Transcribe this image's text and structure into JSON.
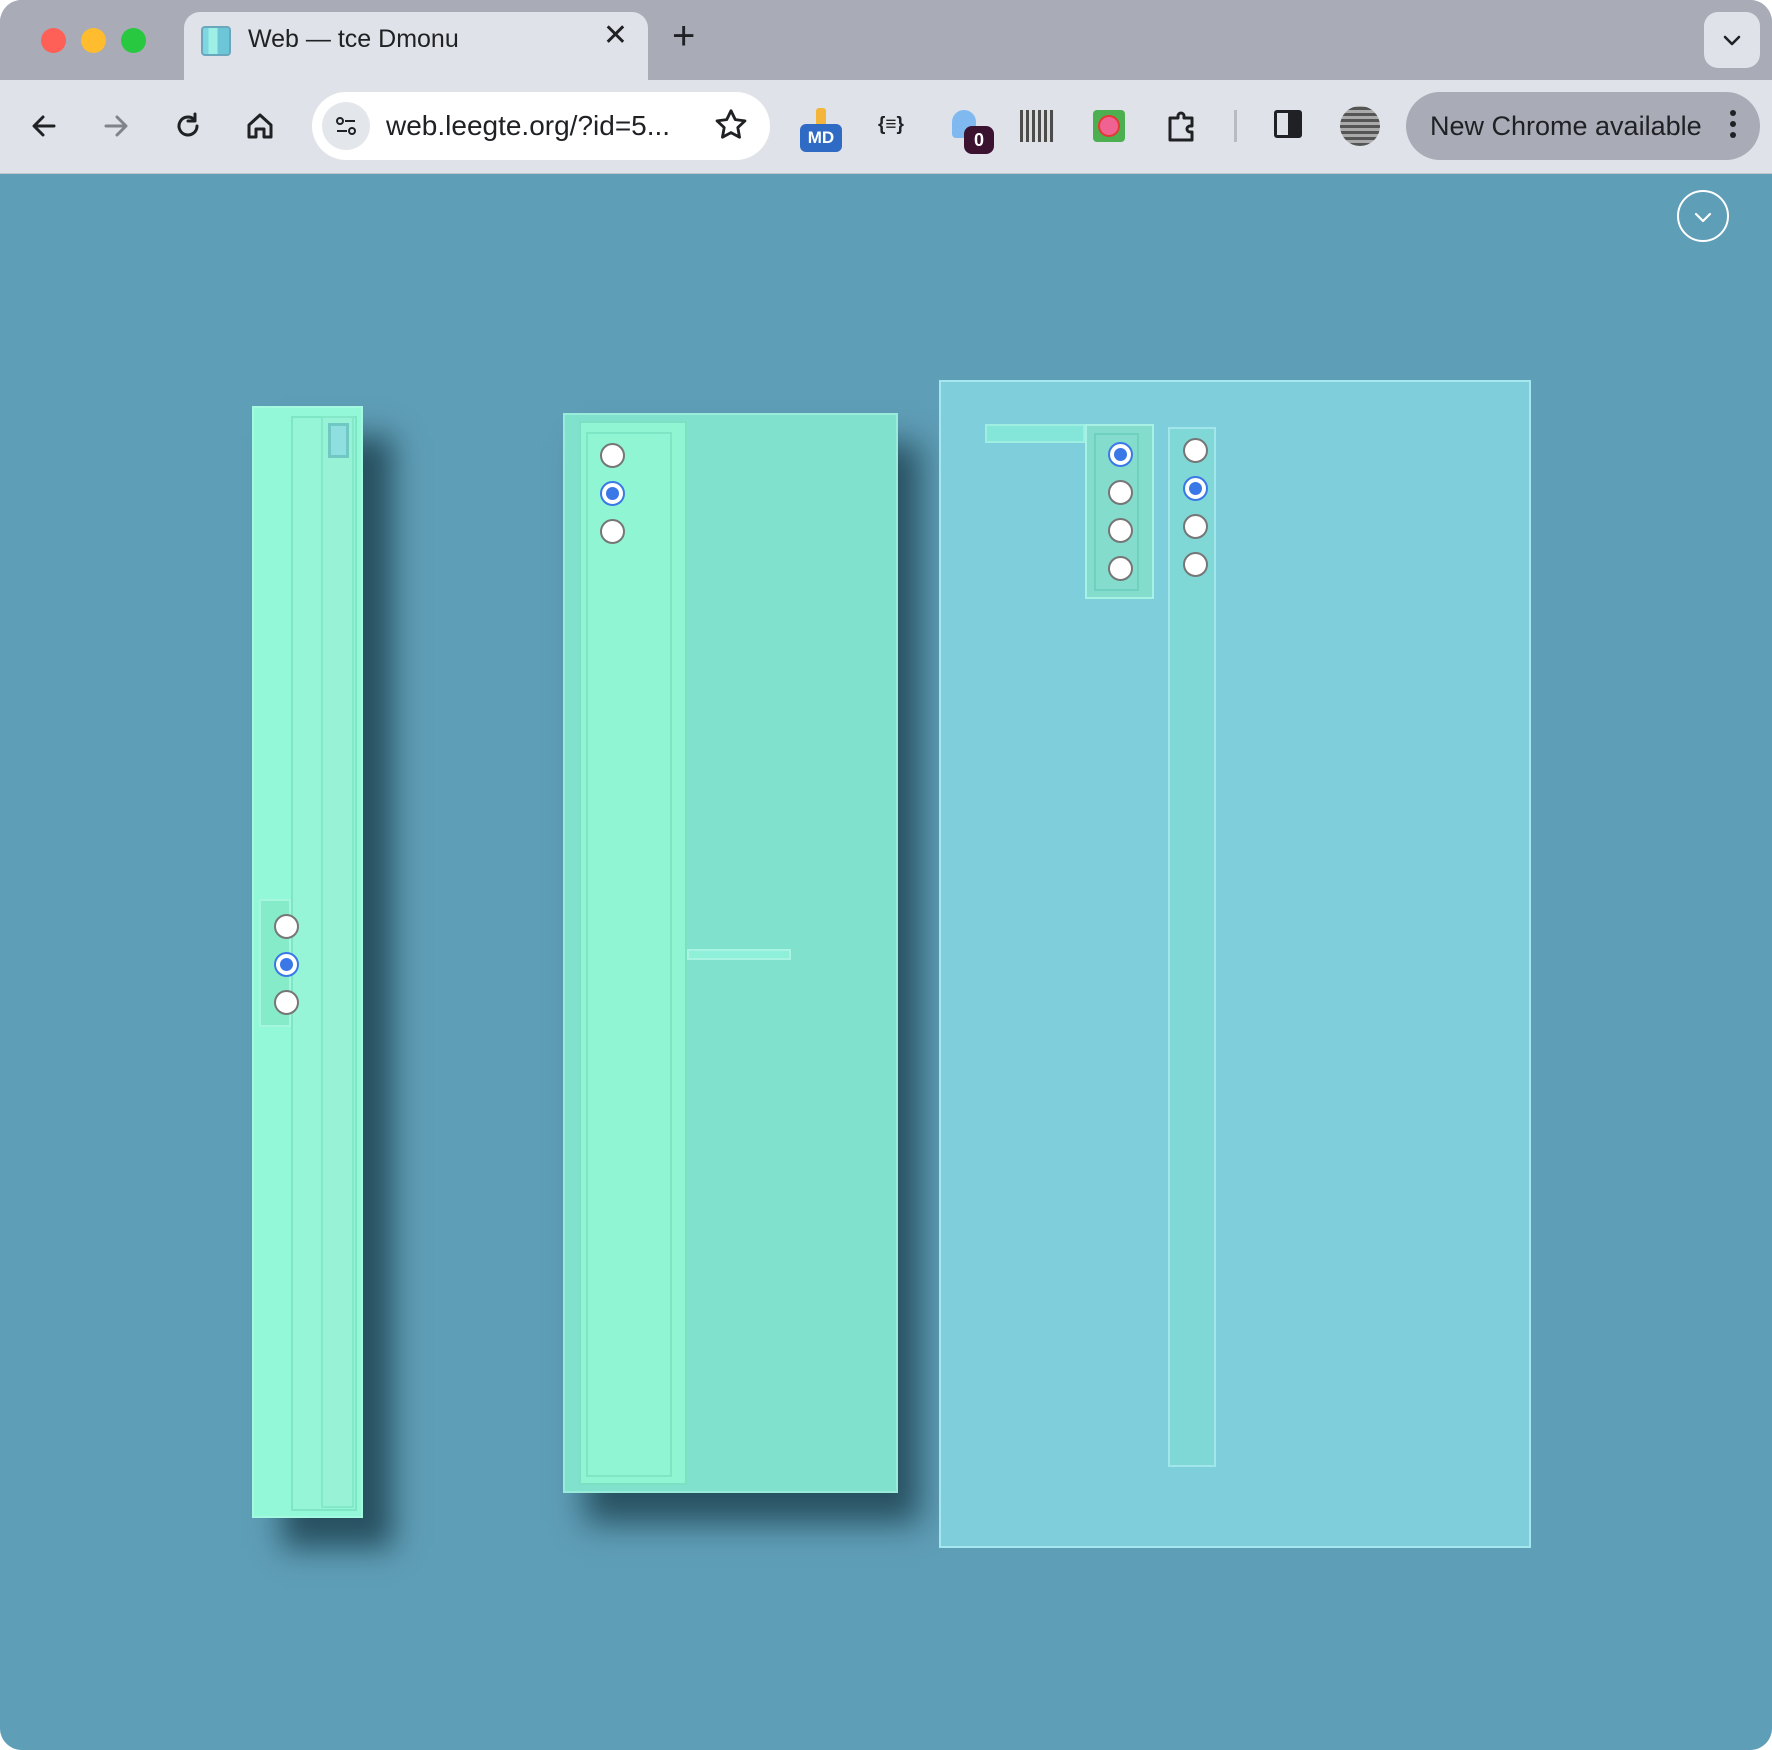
{
  "browser": {
    "tab_title": "Web — tce Dmonu",
    "url": "web.leegte.org/?id=5...",
    "update_label": "New Chrome available",
    "extension_md_label": "MD",
    "extension_ghost_count": "0",
    "extension_braces_label": "{≡}"
  },
  "page": {
    "background_color": "#5f9eb7",
    "panels": [
      {
        "name": "left-panel",
        "color": "#92f8d8",
        "radio_group": [
          false,
          true,
          false
        ]
      },
      {
        "name": "middle-panel",
        "color": "#80e2cd",
        "radio_group": [
          false,
          true,
          false
        ]
      },
      {
        "name": "right-panel",
        "color": "#7fcedb",
        "radio_groups": [
          [
            true,
            false,
            false,
            false
          ],
          [
            false,
            true,
            false,
            false
          ]
        ]
      }
    ]
  }
}
